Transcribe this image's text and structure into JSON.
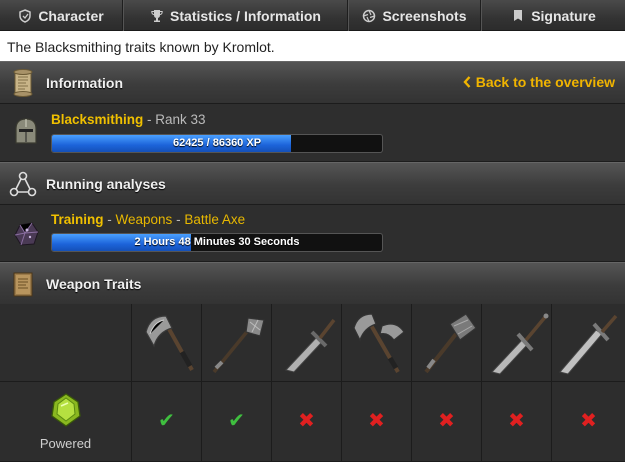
{
  "nav": {
    "tabs": [
      {
        "label": "Character",
        "icon": "shield-icon"
      },
      {
        "label": "Statistics / Information",
        "icon": "trophy-icon"
      },
      {
        "label": "Screenshots",
        "icon": "camera-icon"
      },
      {
        "label": "Signature",
        "icon": "banner-icon"
      }
    ]
  },
  "intro": "The Blacksmithing traits known by Kromlot.",
  "information": {
    "title": "Information",
    "back_link": "Back to the overview",
    "skill": "Blacksmithing",
    "rank_text": " - Rank 33",
    "xp_text": "62425 / 86360 XP",
    "xp_current": 62425,
    "xp_max": 86360
  },
  "analyses": {
    "title": "Running analyses",
    "type": "Training",
    "sep1": " - ",
    "category": "Weapons",
    "sep2": " - ",
    "item": "Battle Axe",
    "time_text": "2 Hours 48 Minutes 30 Seconds",
    "progress": 0.42
  },
  "weapon_traits": {
    "title": "Weapon Traits",
    "weapons": [
      {
        "icon": "axe-icon",
        "known": true
      },
      {
        "icon": "mace-icon",
        "known": true
      },
      {
        "icon": "dagger-icon",
        "known": false
      },
      {
        "icon": "battle-axe-icon",
        "known": false
      },
      {
        "icon": "maul-icon",
        "known": false
      },
      {
        "icon": "sword-icon",
        "known": false
      },
      {
        "icon": "greatsword-icon",
        "known": false
      }
    ],
    "trait": {
      "label": "Powered",
      "icon": "powered-gem-icon"
    }
  },
  "colors": {
    "gold": "#f0c000",
    "xp_bar": "#1c63d9",
    "check": "#3fbf3f",
    "cross": "#e02020"
  }
}
